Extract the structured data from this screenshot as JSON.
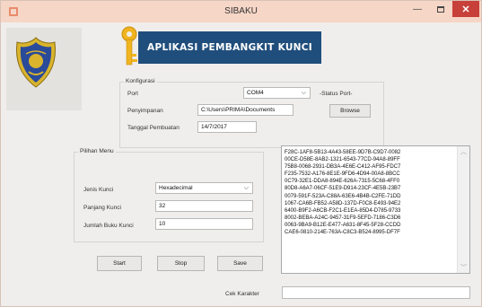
{
  "window": {
    "title": "SIBAKU"
  },
  "banner": {
    "title": "APLIKASI PEMBANGKIT KUNCI"
  },
  "konfigurasi": {
    "group_title": "Konfigurasi",
    "port_label": "Port",
    "port_value": "COM4",
    "status_port": "-Status Port-",
    "penyimpanan_label": "Penyimpanan",
    "penyimpanan_value": "C:\\Users\\PRIMA\\Documents",
    "browse_label": "Browse",
    "tanggal_label": "Tanggal Pembuatan",
    "tanggal_value": "14/7/2017"
  },
  "pilihan_menu": {
    "group_title": "Pilihan Menu",
    "jenis_label": "Jenis Kunci",
    "jenis_value": "Hexadecimal",
    "panjang_label": "Panjang Kunci",
    "panjang_value": "32",
    "jumlah_label": "Jumlah Buku Kunci",
    "jumlah_value": "10"
  },
  "actions": {
    "start": "Start",
    "stop": "Stop",
    "save": "Save"
  },
  "cek_karakter": {
    "label": "Cek Karakter",
    "value": ""
  },
  "output_lines": [
    "F28C-1AF8-5B13-4A43-58EE-9D7B-C9D7-0082",
    "00CE-D58E-8AB2-1321-6543-77CD-94A8-89FF",
    "75B8-0068-2931-DB3A-4E6E-C412-AF95-FDC7",
    "F235-7532-A176-8E1E-9FD6-4D94-00A8-8BCC",
    "0C79-32E1-DDA8-894E-626A-7315-5C68-4FF0",
    "80D8-A6A7-06CF-51E9-D914-23CF-4E5B-23B7",
    "0079-591F-523A-C88A-63E6-4B4B-C2FE-71DD",
    "1067-CA6B-FB52-A58D-137D-F0C8-E493-94E2",
    "6400-B9F2-A6CB-F2C1-E1EA-85D4-D785-9733",
    "8002-BEBA-A24C-9457-31F9-5EFD-7186-C3D6",
    "0063-9BA9-B12E-E477-A631-8F45-5F28-CCDD",
    "CAE6-0810-214E-763A-C8C3-B524-8995-DF7F"
  ]
}
